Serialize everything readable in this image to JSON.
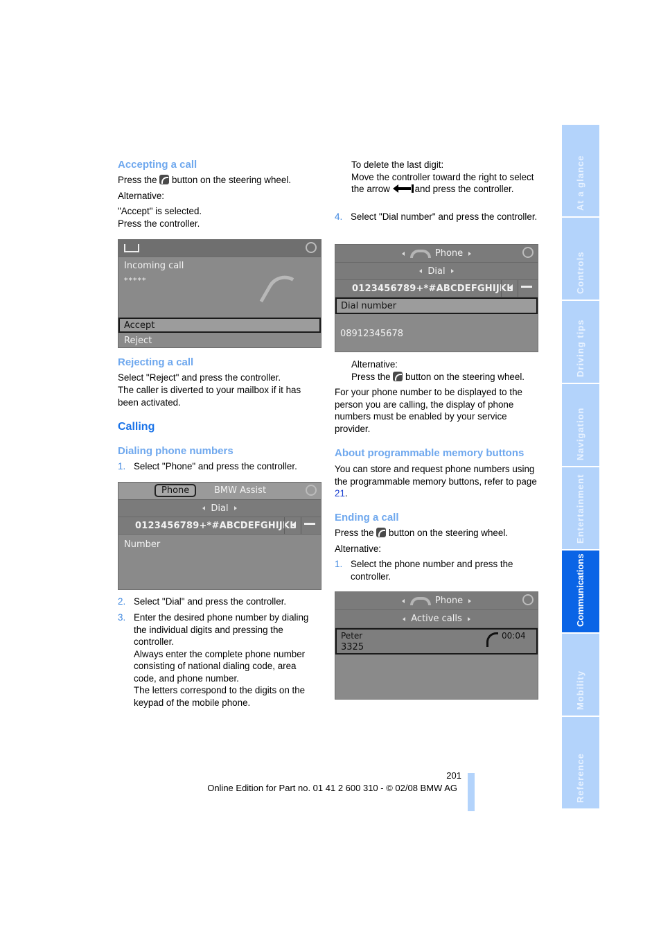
{
  "left_column": {
    "accepting": {
      "heading": "Accepting a call",
      "line1_pre": "Press the",
      "line1_post": "button on the steering wheel.",
      "alternative": "Alternative:",
      "line2": "\"Accept\" is selected.",
      "line3": "Press the controller."
    },
    "screen_incoming": {
      "title": "Incoming call",
      "caller": "*****",
      "options": [
        "Accept",
        "Reject"
      ],
      "selected": "Accept"
    },
    "rejecting": {
      "heading": "Rejecting a call",
      "line1": "Select \"Reject\" and press the controller.",
      "line2": "The caller is diverted to your mailbox if it has been activated."
    },
    "calling": {
      "heading": "Calling"
    },
    "dialing": {
      "heading": "Dialing phone numbers",
      "steps": [
        {
          "num": "1.",
          "text": "Select \"Phone\" and press the controller."
        },
        {
          "num": "2.",
          "text": "Select \"Dial\" and press the controller."
        },
        {
          "num": "3.",
          "text": "Enter the desired phone number by dialing the individual digits and pressing the controller.",
          "extra1": "Always enter the complete phone number consisting of national dialing code, area code, and phone number.",
          "extra2": "The letters correspond to the digits on the keypad of the mobile phone."
        }
      ]
    },
    "screen_phone": {
      "tab_phone": "Phone",
      "tab_assist": "BMW Assist",
      "menu": "Dial",
      "keys": "0123456789+*#ABCDEFGHIJKL",
      "field_label": "Number"
    }
  },
  "right_column": {
    "delete": {
      "line1": "To delete the last digit:",
      "line2": "Move the controller toward the right to select the arrow",
      "line2_post": "and press the controller."
    },
    "step4": {
      "num": "4.",
      "text": "Select \"Dial number\" and press the controller."
    },
    "screen_dial": {
      "header": "Phone",
      "menu": "Dial",
      "keys": "0123456789+*#ABCDEFGHIJKL",
      "selected_item": "Dial number",
      "number": "08912345678"
    },
    "alternative": {
      "label": "Alternative:",
      "line_pre": "Press the",
      "line_post": "button on the steering wheel."
    },
    "display_note": "For your phone number to be displayed to the person you are calling, the display of phone numbers must be enabled by your service provider.",
    "memory": {
      "heading": "About programmable memory buttons",
      "text_pre": "You can store and request phone numbers using the programmable memory buttons, refer to page",
      "page_link": "21",
      "text_post": "."
    },
    "ending": {
      "heading": "Ending a call",
      "line_pre": "Press the",
      "line_post": "button on the steering wheel.",
      "alternative": "Alternative:",
      "step": {
        "num": "1.",
        "text": "Select the phone number and press the controller."
      }
    },
    "screen_active": {
      "header": "Phone",
      "menu": "Active calls",
      "name": "Peter",
      "number": "3325",
      "duration": "00:04"
    }
  },
  "footer": {
    "page_number": "201",
    "edition": "Online Edition for Part no. 01 41 2 600 310 - © 02/08 BMW AG"
  },
  "side_tabs": [
    {
      "label": "At a glance",
      "active": false
    },
    {
      "label": "Controls",
      "active": false
    },
    {
      "label": "Driving tips",
      "active": false
    },
    {
      "label": "Navigation",
      "active": false
    },
    {
      "label": "Entertainment",
      "active": false
    },
    {
      "label": "Communications",
      "active": true
    },
    {
      "label": "Mobility",
      "active": false
    },
    {
      "label": "Reference",
      "active": false
    }
  ],
  "colors": {
    "heading_light": "#6fa8ee",
    "heading_main": "#1a73e8",
    "tab_inactive": "#b3d3fb",
    "tab_active": "#0a64e6",
    "link": "#1a3fd0"
  }
}
